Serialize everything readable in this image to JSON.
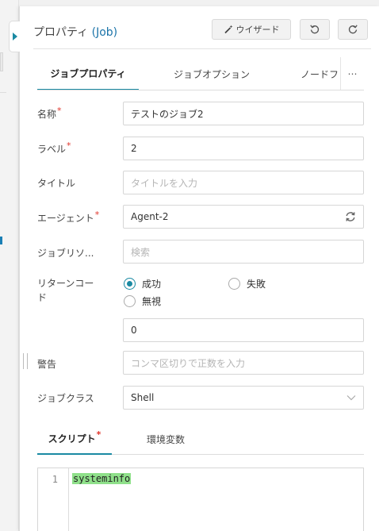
{
  "header": {
    "title_prefix": "プロパティ",
    "title_job": "(Job)",
    "wizard_label": "ウイザード",
    "undo_icon": "undo-icon",
    "redo_icon": "redo-icon"
  },
  "tabs": [
    {
      "label": "ジョブプロパティ",
      "active": true
    },
    {
      "label": "ジョブオプション",
      "active": false
    },
    {
      "label": "ノードフ",
      "active": false
    }
  ],
  "tabs_more": "⋯",
  "form": {
    "name": {
      "label": "名称",
      "required": true,
      "value": "テストのジョブ2"
    },
    "label": {
      "label": "ラベル",
      "required": true,
      "value": "2"
    },
    "title": {
      "label": "タイトル",
      "placeholder": "タイトルを入力"
    },
    "agent": {
      "label": "エージェント",
      "required": true,
      "value": "Agent-2"
    },
    "job_resource": {
      "label": "ジョブリソ...",
      "placeholder": "検索"
    },
    "return_code": {
      "label_line1": "リターンコー",
      "label_line2": "ド",
      "options": [
        {
          "label": "成功",
          "checked": true
        },
        {
          "label": "失敗",
          "checked": false
        },
        {
          "label": "無視",
          "checked": false
        }
      ],
      "value": "0"
    },
    "warning": {
      "label": "警告",
      "placeholder": "コンマ区切りで正数を入力"
    },
    "job_class": {
      "label": "ジョブクラス",
      "value": "Shell"
    }
  },
  "script_tabs": [
    {
      "label": "スクリプト",
      "required": true,
      "active": true
    },
    {
      "label": "環境変数",
      "active": false
    }
  ],
  "editor": {
    "lines": [
      {
        "number": "1",
        "text": "systeminfo"
      }
    ]
  },
  "colors": {
    "accent": "#1a8aa3",
    "link": "#1a73a8",
    "required": "#e0352b",
    "highlight": "#8fe08a"
  }
}
